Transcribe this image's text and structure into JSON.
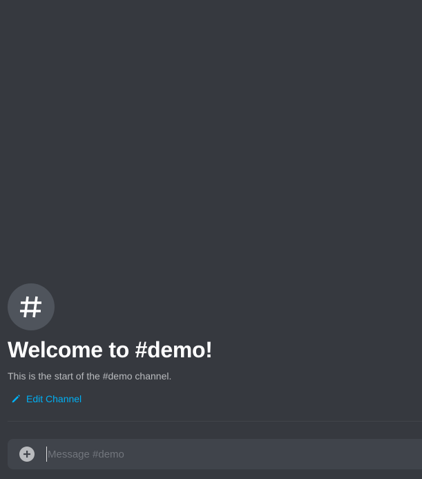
{
  "channel": {
    "icon": "hash-icon",
    "welcome_title": "Welcome to #demo!",
    "welcome_subtitle": "This is the start of the #demo channel.",
    "edit_label": "Edit Channel"
  },
  "composer": {
    "placeholder": "Message #demo",
    "value": "",
    "add_icon": "plus-circle-icon"
  },
  "colors": {
    "background": "#36393f",
    "avatar_bg": "#4f545c",
    "link": "#00b0f4",
    "composer_bg": "#40444b",
    "title": "#ffffff",
    "muted_text": "#b9bbbe"
  }
}
